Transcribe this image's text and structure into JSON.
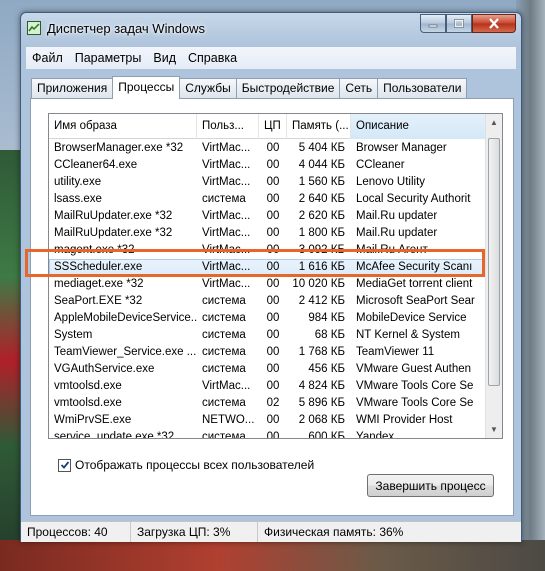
{
  "window": {
    "title": "Диспетчер задач Windows",
    "controls": {
      "minimize_icon": "minimize-icon",
      "maximize_icon": "maximize-icon",
      "close_icon": "close-icon"
    }
  },
  "menu": [
    "Файл",
    "Параметры",
    "Вид",
    "Справка"
  ],
  "tabs": [
    "Приложения",
    "Процессы",
    "Службы",
    "Быстродействие",
    "Сеть",
    "Пользователи"
  ],
  "active_tab": "Процессы",
  "table": {
    "columns": [
      "Имя образа",
      "Польз...",
      "ЦП",
      "Память (...",
      "Описание"
    ],
    "sorted_column": "Описание",
    "rows": [
      {
        "name": "BrowserManager.exe *32",
        "user": "VirtMac...",
        "cpu": "00",
        "mem": "5 404 КБ",
        "desc": "Browser Manager"
      },
      {
        "name": "CCleaner64.exe",
        "user": "VirtMac...",
        "cpu": "00",
        "mem": "4 044 КБ",
        "desc": "CCleaner"
      },
      {
        "name": "utility.exe",
        "user": "VirtMac...",
        "cpu": "00",
        "mem": "1 560 КБ",
        "desc": "Lenovo Utility"
      },
      {
        "name": "lsass.exe",
        "user": "система",
        "cpu": "00",
        "mem": "2 640 КБ",
        "desc": "Local Security Authorit"
      },
      {
        "name": "MailRuUpdater.exe *32",
        "user": "VirtMac...",
        "cpu": "00",
        "mem": "2 620 КБ",
        "desc": "Mail.Ru updater"
      },
      {
        "name": "MailRuUpdater.exe *32",
        "user": "VirtMac...",
        "cpu": "00",
        "mem": "1 800 КБ",
        "desc": "Mail.Ru updater"
      },
      {
        "name": "magent.exe *32",
        "user": "VirtMac...",
        "cpu": "00",
        "mem": "3 092 КБ",
        "desc": "Mail.Ru Агент"
      },
      {
        "name": "SSScheduler.exe",
        "user": "VirtMac...",
        "cpu": "00",
        "mem": "1 616 КБ",
        "desc": "McAfee Security Scanı",
        "selected": true
      },
      {
        "name": "mediaget.exe *32",
        "user": "VirtMac...",
        "cpu": "00",
        "mem": "10 020 КБ",
        "desc": "MediaGet torrent client"
      },
      {
        "name": "SeaPort.EXE *32",
        "user": "система",
        "cpu": "00",
        "mem": "2 412 КБ",
        "desc": "Microsoft SeaPort Sear"
      },
      {
        "name": "AppleMobileDeviceService...",
        "user": "система",
        "cpu": "00",
        "mem": "984 КБ",
        "desc": "MobileDevice Service"
      },
      {
        "name": "System",
        "user": "система",
        "cpu": "00",
        "mem": "68 КБ",
        "desc": "NT Kernel & System"
      },
      {
        "name": "TeamViewer_Service.exe ...",
        "user": "система",
        "cpu": "00",
        "mem": "1 768 КБ",
        "desc": "TeamViewer 11"
      },
      {
        "name": "VGAuthService.exe",
        "user": "система",
        "cpu": "00",
        "mem": "456 КБ",
        "desc": "VMware Guest Authen"
      },
      {
        "name": "vmtoolsd.exe",
        "user": "VirtMac...",
        "cpu": "00",
        "mem": "4 824 КБ",
        "desc": "VMware Tools Core Se"
      },
      {
        "name": "vmtoolsd.exe",
        "user": "система",
        "cpu": "02",
        "mem": "5 896 КБ",
        "desc": "VMware Tools Core Se"
      },
      {
        "name": "WmiPrvSE.exe",
        "user": "NETWO...",
        "cpu": "00",
        "mem": "2 068 КБ",
        "desc": "WMI Provider Host"
      },
      {
        "name": "service_update.exe *32",
        "user": "система",
        "cpu": "00",
        "mem": "600 КБ",
        "desc": "Yandex"
      }
    ]
  },
  "show_all_users": {
    "label": "Отображать процессы всех пользователей",
    "checked": true
  },
  "end_process_button": "Завершить процесс",
  "status": {
    "processes": "Процессов: 40",
    "cpu_load": "Загрузка ЦП: 3%",
    "physical_memory": "Физическая память: 36%"
  },
  "colors": {
    "highlight_frame": "#e8662a",
    "selected_row": "#dcebfa"
  }
}
